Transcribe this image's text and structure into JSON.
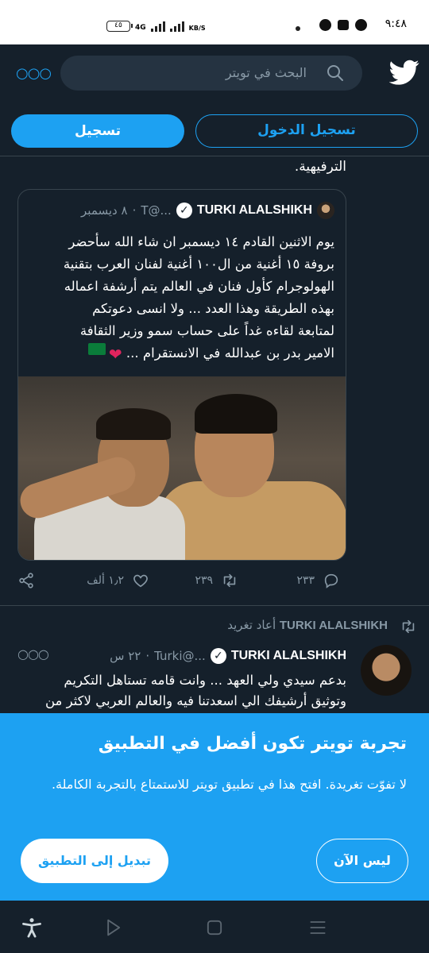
{
  "status_bar": {
    "time": "٩:٤٨",
    "battery": "٤٥",
    "network": "4G",
    "speed_unit": "KB/S"
  },
  "top_bar": {
    "search_placeholder": "البحث في تويتر",
    "more_icon": "more-dots-icon",
    "logo_icon": "twitter-bird-icon"
  },
  "auth": {
    "login_label": "تسجيل الدخول",
    "signup_label": "تسجيل"
  },
  "previous_tweet_tail": "الترفيهية.",
  "quoted_tweet": {
    "author_name": "TURKI ALALSHIKH",
    "handle": "...@T",
    "date": "٨ ديسمبر",
    "separator": "·",
    "lines": [
      "يوم الاثنين القادم ١٤ ديسمبر ان شاء الله سأحضر",
      "بروفة ١٥ أغنية من ال١٠٠ أغنية لفنان العرب بتقنية",
      "الهولوجرام كأول فنان في العالم يتم أرشفة اعماله",
      "بهذه الطريقة وهذا العدد ... ولا انسى دعوتكم",
      "لمتابعة لقاءه غداً على حساب سمو وزير الثقافة",
      "الامير بدر بن عبدالله في الانستقرام ..."
    ],
    "emoji": [
      "heart",
      "saudi-flag"
    ]
  },
  "actions": {
    "replies": "٢٣٣",
    "retweets": "٢٣٩",
    "likes": "١٫٢ ألف"
  },
  "retweet_context": {
    "retweeter": "TURKI ALALSHIKH",
    "label": "أعاد تغريد"
  },
  "tweet": {
    "author_name": "TURKI ALALSHIKH",
    "handle": "...@Turki",
    "time": "٢٢ س",
    "separator": "·",
    "lines": [
      "بدعم سيدي ولي العهد ... وانت قامه تستاهل التكريم",
      "وتوثيق أرشيفك الي اسعدتنا فيه والعالم العربي لاكثر من"
    ]
  },
  "app_prompt": {
    "title": "تجربة تويتر تكون أفضل في التطبيق",
    "body": "لا تفوّت تغريدة. افتح هذا في تطبيق تويتر للاستمتاع بالتجربة الكاملة.",
    "not_now_label": "ليس الآن",
    "switch_label": "تبديل إلى التطبيق"
  },
  "colors": {
    "background": "#15202b",
    "accent": "#1da1f2",
    "secondary_text": "#8899a6",
    "divider": "#38444d",
    "heart": "#e0245e"
  }
}
